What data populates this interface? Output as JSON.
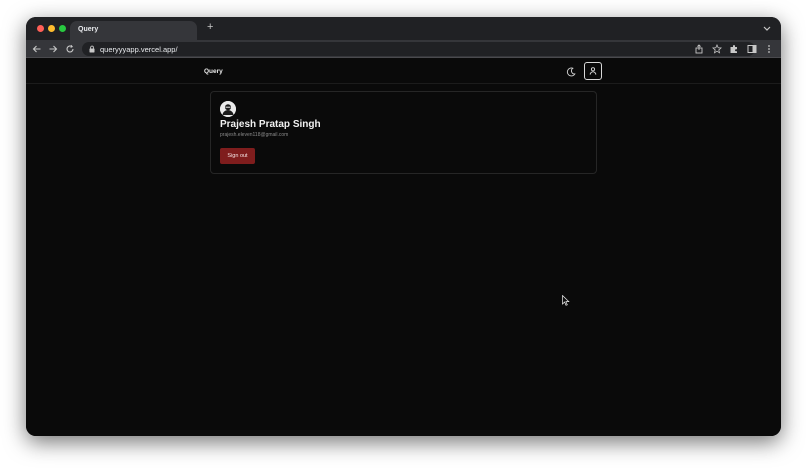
{
  "browser": {
    "tab_title": "Query",
    "new_tab_symbol": "+",
    "url": "queryyyapp.vercel.app/"
  },
  "app": {
    "brand": "Query"
  },
  "profile": {
    "name": "Prajesh Pratap Singh",
    "email": "prajesh.eleven118@gmail.com",
    "signout_label": "Sign out"
  },
  "colors": {
    "page_bg": "#0a0a0a",
    "signout_bg": "#7f1d1d",
    "tab_bg": "#35363a",
    "strip_bg": "#202124"
  },
  "icons": {
    "theme_toggle": "moon-icon",
    "profile_button": "user-icon",
    "avatar": "user-avatar"
  }
}
